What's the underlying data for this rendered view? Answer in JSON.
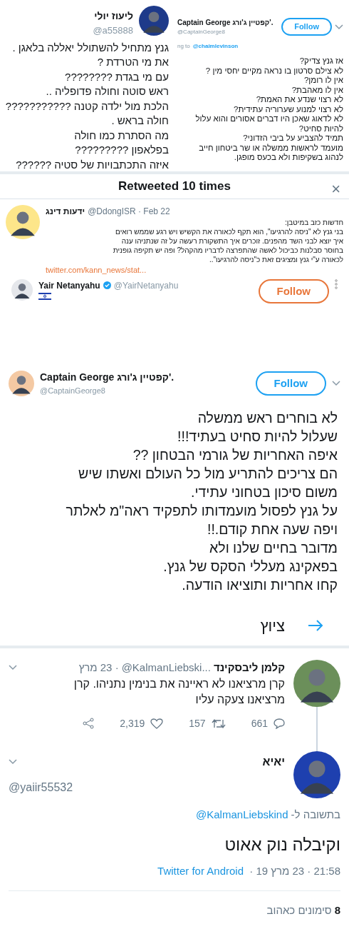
{
  "left_tweet": {
    "name": "ליעוז יולי",
    "handle": "@a55888",
    "lines": [
      "גנץ מתחיל להשתולל יאללה בלאגן .",
      "את מי הטרדת ?",
      "עם מי בגדת ????????",
      "ראש סוטה וחולה פדופליה ..",
      "הלכת מול ילדה קטנה ???????????",
      "חולה בראש .",
      "מה הסתרת כמו חולה",
      "בפלאפון ?????????",
      "איזה התכתבויות של סטיה ??????"
    ]
  },
  "right_tweet": {
    "name": "Captain George קפטיין ג'ורג'.",
    "handle": "@CaptainGeorge8",
    "follow": "Follow",
    "replying": "ng to",
    "reply_to": "@chaimlevinson",
    "lines": [
      "אז גנץ צדיק?",
      "לא צילם סרטון בו נראה מקיים יחסי מין ?",
      "אין לו רומן?",
      "אין לו מאהבת?",
      "לא רצוי שנדע את האמת?",
      "לא רצוי למנוע שערוריה עתידית?",
      "לא לדאוג שאכן היו דברים אסורים והוא עלול",
      "להיות סחיט?",
      "תמיד להצביע על ביבי הזדוני?",
      "מועמד לראשות ממשלה או שר ביטחון חייב",
      "לנהוג בשקיפות ולא בכעס מופגן."
    ]
  },
  "retweets_dialog": {
    "title": "Retweeted 10 times",
    "close": "×",
    "tweet": {
      "name": "ידעות דינג",
      "handle": "@DdongISR · Feb 22",
      "lines": [
        "חדשות כזב במיטבן:",
        "בני גנץ לא \"ניסה להרגיעו\", הוא תקף לכאורה את הקשיש ויש רגע שממש רואים",
        "איך יוצא לבני השד מהפנים. זוכרים איך התשקורת רעשה על זה שנתניהו ענה",
        "בחוסר סבלנות כביכול לאשה שהתפרצה לדבריו מהקהל? ופה יש תקיפה גופנית",
        "לכאורה ע\"י גנץ ומציגים זאת כ\"ניסה להרגיעו\".."
      ],
      "link": "twitter.com/kann_news/stat..."
    },
    "user": {
      "name": "Yair Netanyahu",
      "verified": true,
      "handle": "@YairNetanyahu",
      "follow": "Follow"
    }
  },
  "main_tweet": {
    "name": "Captain George קפטיין ג'ורג'.",
    "handle": "@CaptainGeorge8",
    "follow": "Follow",
    "lines": [
      "לא בוחרים ראש ממשלה",
      "שעלול להיות סחיט בעתיד!!!",
      "איפה האחריות של גורמי הבטחון ??",
      "הם צריכים להתריע מול כל העולם ואשתו שיש",
      "משום סיכון בטחוני עתידי.",
      "על גנץ לפסול מועמדותו לתפקיד ראה\"מ לאלתר",
      "ויפה שעה אחת קודם.!!",
      "מדובר בחיים שלנו ולא",
      "בפאקינג מעללי הסקס של גנץ.",
      "קחו אחריות ותוציאו הודעה."
    ],
    "tweet_button": "ציוץ"
  },
  "thread": {
    "tweet": {
      "name": "קלמן ליבסקינד",
      "handle": "@KalmanLiebski...",
      "date": "· 23 מרץ",
      "lines": [
        "קרן מרציאנו לא ראיינה את בנימין נתניהו. קרן",
        "מרציאנו צעקה עליו"
      ],
      "replies": "661",
      "retweets": "157",
      "likes": "2,319"
    },
    "reply": {
      "name": "יאיא",
      "handle": "@yaiir55532",
      "replying": "בתשובה ל-",
      "reply_to": "@KalmanLiebskind",
      "text": "וקיבלה נוק אאוט",
      "time": "21:58 · 23 מרץ 19 · ",
      "source": "Twitter for Android",
      "likes_count": "8",
      "likes_label": "סימונים כאהוב"
    }
  }
}
